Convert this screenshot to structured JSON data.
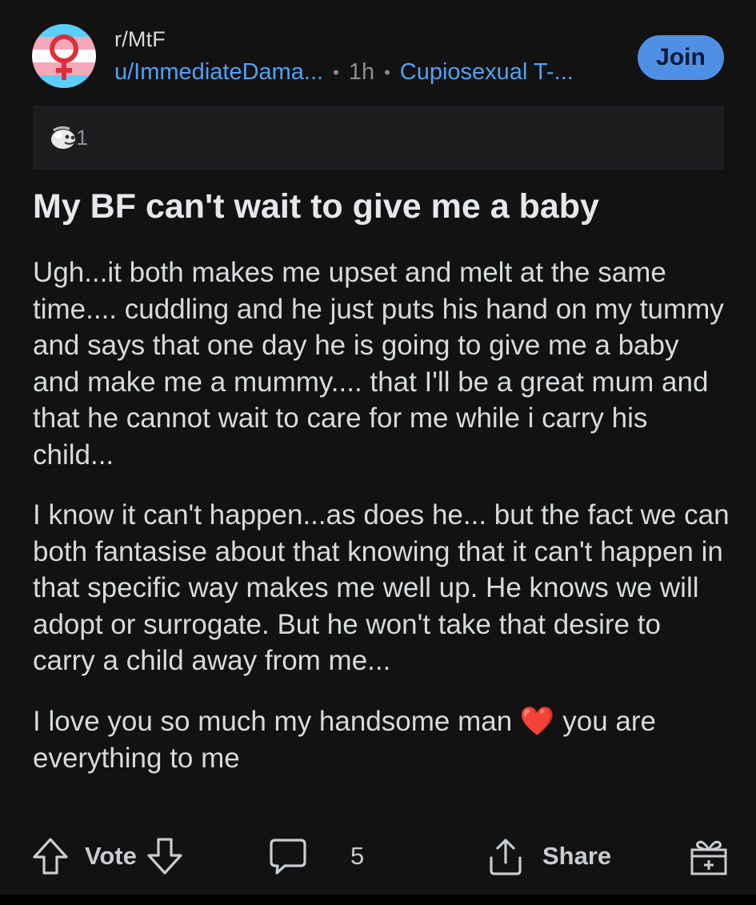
{
  "header": {
    "subreddit": "r/MtF",
    "username": "u/ImmediateDama...",
    "separator": "•",
    "time": "1h",
    "flair": "Cupiosexual T-...",
    "join_label": "Join"
  },
  "awards": {
    "count": "1"
  },
  "post": {
    "title": "My BF can't wait to give me a baby",
    "paragraphs": [
      "Ugh...it both makes me upset and melt at the same time.... cuddling and he just puts his hand on my tummy and says that one day he is going to give me a baby and make me a mummy.... that I'll be a great mum and that he cannot wait to care for me while i carry his child...",
      "I know it can't happen...as does he... but the fact we can both fantasise about that knowing that it can't happen in that specific way makes me well up. He knows we will adopt or surrogate. But he won't take that desire to carry a child away from me..."
    ],
    "closing_before": "I love you so much my handsome man",
    "closing_emoji": "❤️",
    "closing_after": "you are everything to me"
  },
  "actions": {
    "vote_label": "Vote",
    "comments_count": "5",
    "share_label": "Share"
  },
  "colors": {
    "background": "#121212",
    "link_blue": "#4fa3f7",
    "join_button": "#4f8fe6",
    "trans_blue": "#5bcefa",
    "trans_pink": "#f5a9b8",
    "heart_red": "#e0262f"
  }
}
